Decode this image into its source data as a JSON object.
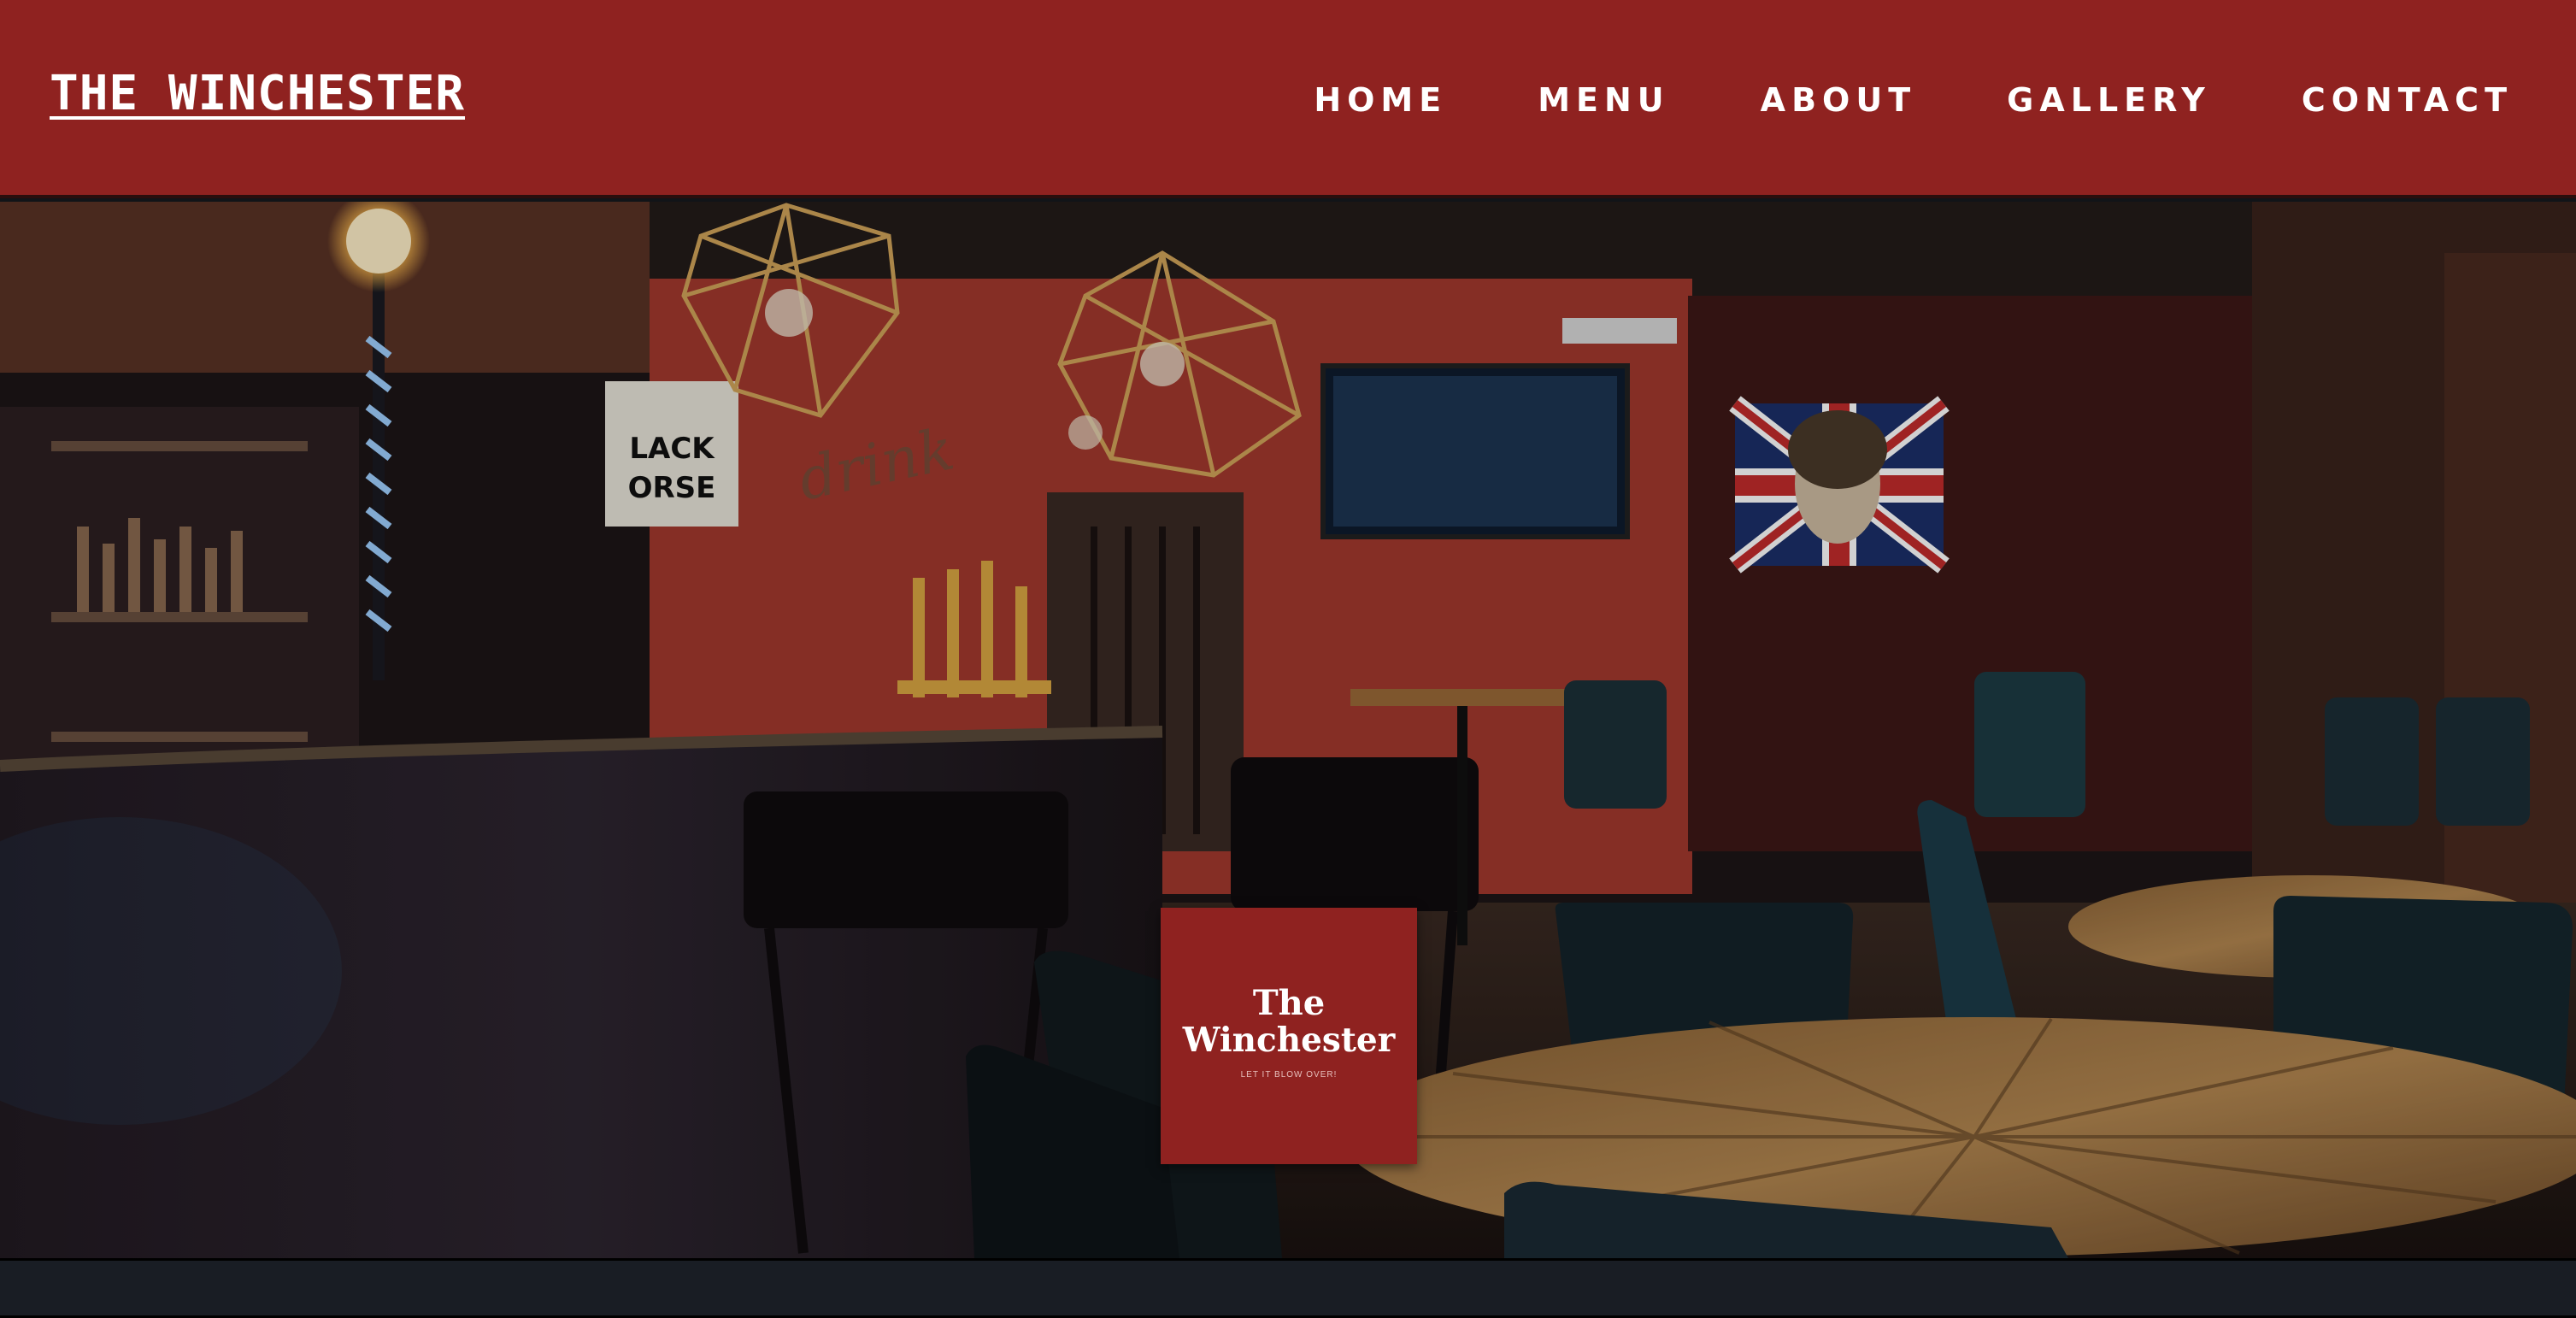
{
  "header": {
    "logo_text": "THE WINCHESTER",
    "background_color": "#8f2220"
  },
  "nav": {
    "items": [
      {
        "label": "HOME"
      },
      {
        "label": "MENU"
      },
      {
        "label": "ABOUT"
      },
      {
        "label": "GALLERY"
      },
      {
        "label": "CONTACT"
      }
    ]
  },
  "hero": {
    "badge": {
      "line1": "The",
      "line2": "Winchester",
      "tagline": "LET IT BLOW OVER!"
    },
    "wall_sign": {
      "script_word": "drink",
      "poster_text_line1": "LACK",
      "poster_text_line2": "ORSE"
    }
  },
  "colors": {
    "brand_red": "#8f2220",
    "footer": "#191d24"
  }
}
